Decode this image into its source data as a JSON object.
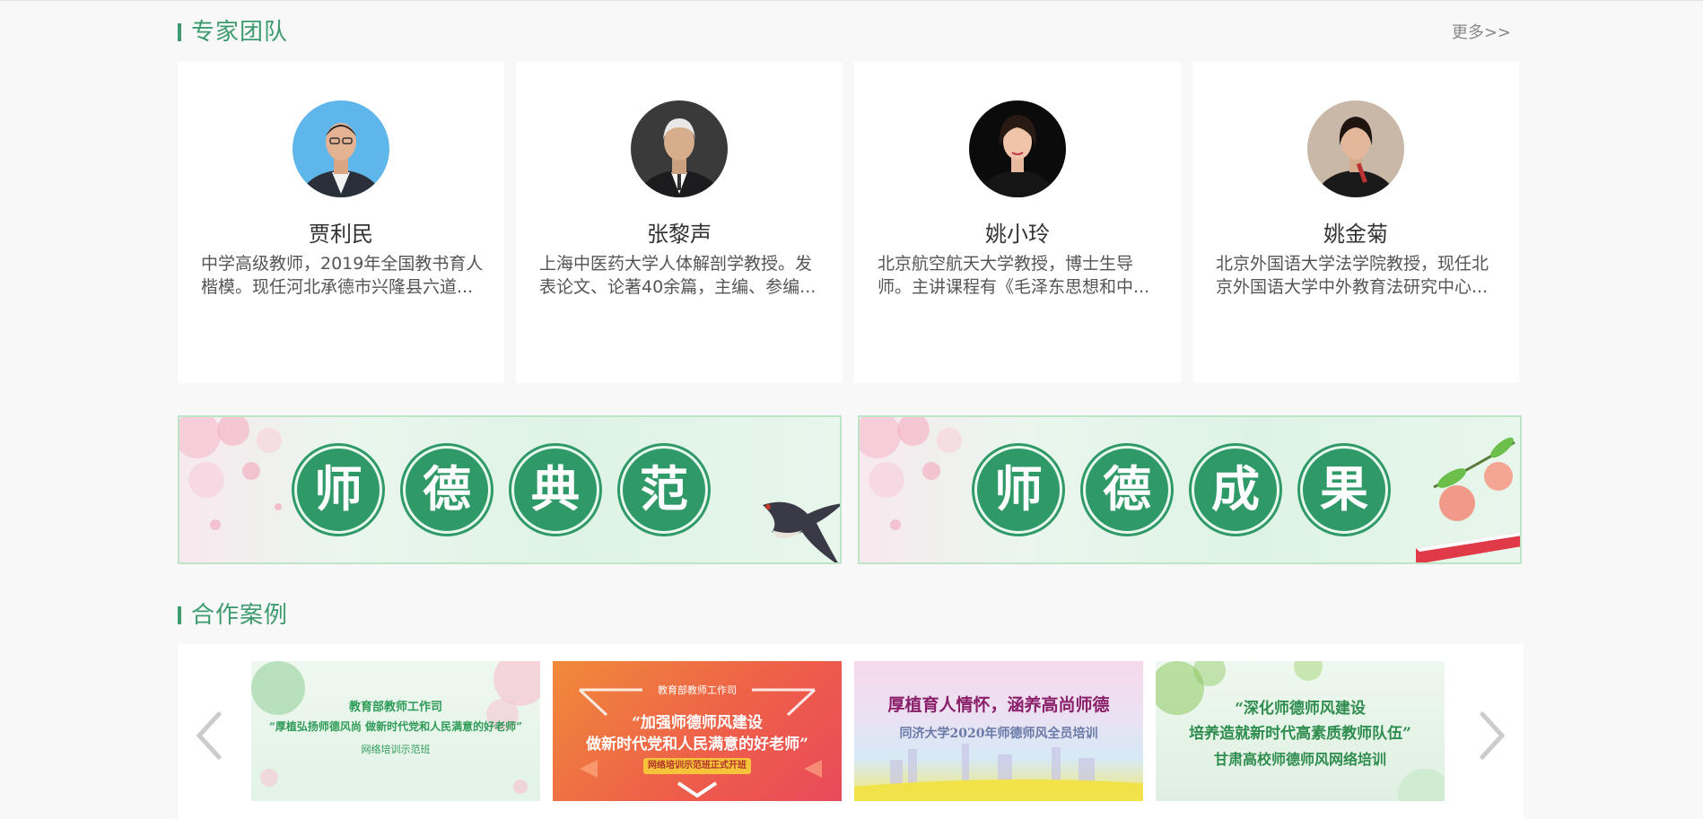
{
  "experts_section": {
    "title": "专家团队",
    "more": "更多>>"
  },
  "experts": [
    {
      "name": "贾利民",
      "desc": "中学高级教师，2019年全国教书育人楷模。现任河北承德市兴隆县六道...",
      "avatar_icon": "portrait-photo"
    },
    {
      "name": "张黎声",
      "desc": "上海中医药大学人体解剖学教授。发表论文、论著40余篇，主编、参编...",
      "avatar_icon": "portrait-photo"
    },
    {
      "name": "姚小玲",
      "desc": "北京航空航天大学教授，博士生导师。主讲课程有《毛泽东思想和中...",
      "avatar_icon": "portrait-photo"
    },
    {
      "name": "姚金菊",
      "desc": "北京外国语大学法学院教授，现任北京外国语大学中外教育法研究中心...",
      "avatar_icon": "portrait-photo"
    }
  ],
  "banners": [
    {
      "chars": [
        "师",
        "德",
        "典",
        "范"
      ],
      "decor_icon": "swallow-icon"
    },
    {
      "chars": [
        "师",
        "德",
        "成",
        "果"
      ],
      "decor_icon": "peach-book-icon"
    }
  ],
  "cases_section": {
    "title": "合作案例"
  },
  "cases": [
    {
      "top": "教育部教师工作司",
      "line1": "“厚植弘扬师德风尚 做新时代党和人民满意的好老师”",
      "line2": "网络培训示范班"
    },
    {
      "top": "教育部教师工作司",
      "line1": "“加强师德师风建设",
      "line2": "做新时代党和人民满意的好老师”",
      "badge": "网络培训示范班正式开班"
    },
    {
      "line1": "厚植育人情怀，涵养高尚师德",
      "line2": "同济大学2020年师德师风全员培训"
    },
    {
      "line1": "“深化师德师风建设",
      "line2": "培养造就新时代高素质教师队伍”",
      "line3": "甘肃高校师德师风网络培训"
    }
  ],
  "colors": {
    "accent": "#3d9b6f",
    "coin": "#2f9a68",
    "arrow": "#cccccc"
  }
}
